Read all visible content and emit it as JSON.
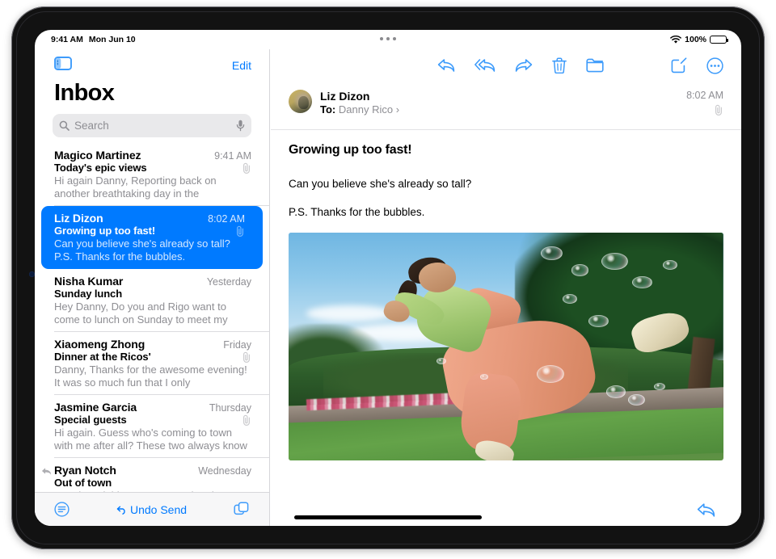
{
  "status_bar": {
    "time": "9:41 AM",
    "date": "Mon Jun 10",
    "battery_percent": "100%",
    "wifi_icon": "wifi-icon",
    "battery_icon": "battery-full-icon",
    "multitask_icon": "multitasking-dots-icon"
  },
  "sidebar": {
    "toggle_icon": "sidebar-toggle-icon",
    "edit_label": "Edit",
    "title": "Inbox",
    "search": {
      "placeholder": "Search",
      "search_icon": "search-icon",
      "mic_icon": "microphone-icon"
    },
    "messages": [
      {
        "sender": "Magico Martinez",
        "time": "9:41 AM",
        "subject": "Today's epic views",
        "preview": "Hi again Danny, Reporting back on another breathtaking day in the mountains. Wide o…",
        "has_attachment": true,
        "selected": false,
        "replied": false
      },
      {
        "sender": "Liz Dizon",
        "time": "8:02 AM",
        "subject": "Growing up too fast!",
        "preview": "Can you believe she's already so tall? P.S. Thanks for the bubbles.",
        "has_attachment": true,
        "selected": true,
        "replied": false
      },
      {
        "sender": "Nisha Kumar",
        "time": "Yesterday",
        "subject": "Sunday lunch",
        "preview": "Hey Danny, Do you and Rigo want to come to lunch on Sunday to meet my dad? If you…",
        "has_attachment": false,
        "selected": false,
        "replied": false
      },
      {
        "sender": "Xiaomeng Zhong",
        "time": "Friday",
        "subject": "Dinner at the Ricos'",
        "preview": "Danny, Thanks for the awesome evening! It was so much fun that I only remembered t…",
        "has_attachment": true,
        "selected": false,
        "replied": false
      },
      {
        "sender": "Jasmine Garcia",
        "time": "Thursday",
        "subject": "Special guests",
        "preview": "Hi again. Guess who's coming to town with me after all? These two always know how t…",
        "has_attachment": true,
        "selected": false,
        "replied": false
      },
      {
        "sender": "Ryan Notch",
        "time": "Wednesday",
        "subject": "Out of town",
        "preview": "Howdy, neighbor, Just wanted to drop a quick note to let you know we're leaving T…",
        "has_attachment": false,
        "selected": false,
        "replied": true
      }
    ],
    "bottom_bar": {
      "filter_icon": "filter-icon",
      "undo_send_label": "Undo Send",
      "undo_icon": "undo-arrow-icon",
      "tabs_icon": "new-window-icon"
    }
  },
  "detail": {
    "toolbar": {
      "reply_icon": "reply-icon",
      "reply_all_icon": "reply-all-icon",
      "forward_icon": "forward-icon",
      "trash_icon": "trash-icon",
      "folder_icon": "folder-icon",
      "compose_icon": "compose-icon",
      "more_icon": "more-circle-icon"
    },
    "message": {
      "avatar": "contact-avatar",
      "sender": "Liz Dizon",
      "to_label": "To:",
      "to_recipient": "Danny Rico",
      "disclosure_icon": "chevron-right-icon",
      "time": "8:02 AM",
      "attachment_icon": "paperclip-icon",
      "subject": "Growing up too fast!",
      "paragraphs": [
        "Can you believe she's already so tall?",
        "P.S. Thanks for the bubbles."
      ],
      "photo_alt": "Girl kicking with bubbles in a garden"
    },
    "footer": {
      "reply_icon": "reply-icon"
    }
  },
  "colors": {
    "accent": "#007aff",
    "selected_row": "#007aff",
    "secondary_text": "#8e8e93",
    "search_bg": "#e9e9eb"
  }
}
